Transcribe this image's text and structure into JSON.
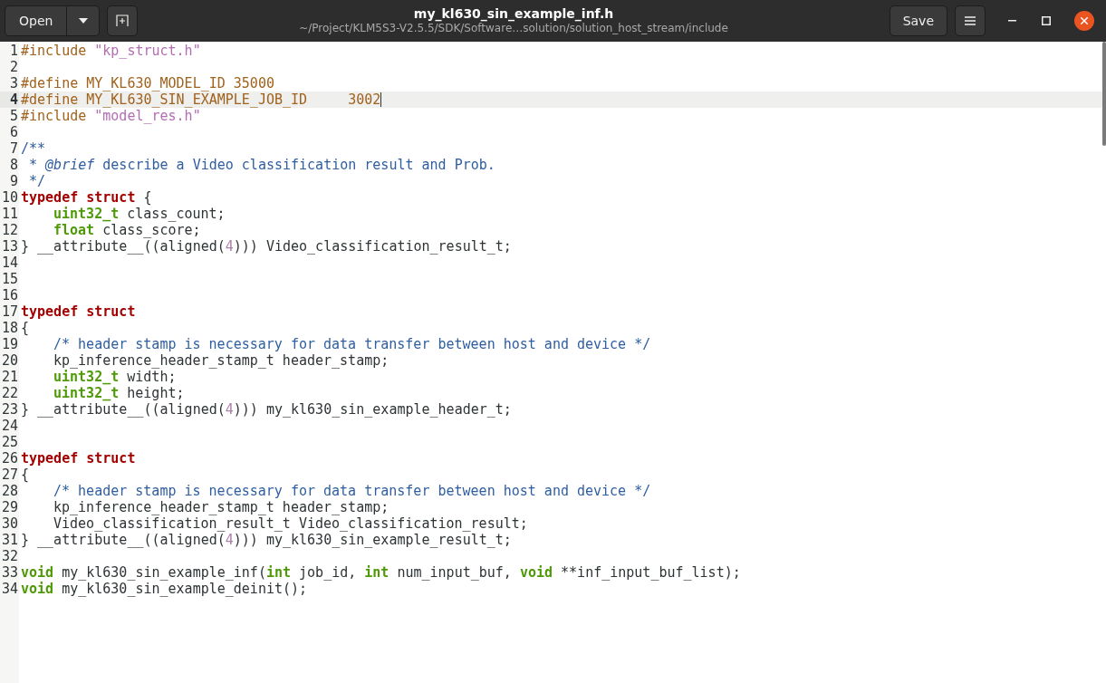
{
  "header": {
    "open_label": "Open",
    "title": "my_kl630_sin_example_inf.h",
    "subtitle": "~/Project/KLM5S3-V2.5.5/SDK/Software…solution/solution_host_stream/include",
    "save_label": "Save"
  },
  "lines": [
    {
      "number": "1",
      "current": false,
      "tokens": [
        {
          "kind": "preprocessor",
          "t": "#include "
        },
        {
          "kind": "string",
          "t": "\"kp_struct.h\""
        }
      ]
    },
    {
      "number": "2",
      "current": false
    },
    {
      "number": "3",
      "current": false,
      "tokens": [
        {
          "kind": "preprocessor",
          "t": "#define MY_KL630_MODEL_ID 35000"
        }
      ]
    },
    {
      "number": "4",
      "current": true,
      "tokens": [
        {
          "kind": "preprocessor",
          "t": "#define MY_KL630_SIN_EXAMPLE_JOB_ID     3002"
        }
      ]
    },
    {
      "number": "5",
      "current": false,
      "tokens": [
        {
          "kind": "preprocessor",
          "t": "#include "
        },
        {
          "kind": "string",
          "t": "\"model_res.h\""
        }
      ]
    },
    {
      "number": "6",
      "current": false
    },
    {
      "number": "7",
      "current": false,
      "tokens": [
        {
          "kind": "comment",
          "t": "/**"
        }
      ]
    },
    {
      "number": "8",
      "current": false,
      "tokens": [
        {
          "kind": "comment",
          "t": " * "
        },
        {
          "kind": "doc_tag",
          "t": "@brief"
        },
        {
          "kind": "comment",
          "t": " describe a Video classification result and Prob."
        }
      ]
    },
    {
      "number": "9",
      "current": false,
      "tokens": [
        {
          "kind": "comment",
          "t": " */"
        }
      ]
    },
    {
      "number": "10",
      "current": false,
      "tokens": [
        {
          "kind": "keyword",
          "t": "typedef struct"
        },
        {
          "kind": "plain",
          "t": " {"
        }
      ],
      "children": [
        {
          "number": "11",
          "current": false,
          "tokens": [
            {
              "kind": "type",
              "t": "uint32_t"
            },
            {
              "kind": "plain",
              "t": " class_count;"
            }
          ]
        },
        {
          "number": "12",
          "current": false,
          "tokens": [
            {
              "kind": "type",
              "t": "float"
            },
            {
              "kind": "plain",
              "t": " class_score;"
            }
          ]
        }
      ]
    },
    {
      "number": "13",
      "current": false,
      "tokens": [
        {
          "kind": "plain",
          "t": "} __attribute__((aligned("
        },
        {
          "kind": "number",
          "t": "4"
        },
        {
          "kind": "plain",
          "t": "))) Video_classification_result_t;"
        }
      ]
    },
    {
      "number": "14",
      "current": false
    },
    {
      "number": "15",
      "current": false
    },
    {
      "number": "16",
      "current": false
    },
    {
      "number": "17",
      "current": false,
      "tokens": [
        {
          "kind": "keyword",
          "t": "typedef struct"
        }
      ]
    },
    {
      "number": "18",
      "current": false,
      "tokens": [
        {
          "kind": "plain",
          "t": "{"
        }
      ],
      "children": [
        {
          "number": "19",
          "current": false,
          "tokens": [
            {
              "kind": "comment",
              "t": "/* header stamp is necessary for data transfer between host and device */"
            }
          ]
        },
        {
          "number": "20",
          "current": false,
          "tokens": [
            {
              "kind": "plain",
              "t": "kp_inference_header_stamp_t header_stamp;"
            }
          ]
        },
        {
          "number": "21",
          "current": false,
          "tokens": [
            {
              "kind": "type",
              "t": "uint32_t"
            },
            {
              "kind": "plain",
              "t": " width;"
            }
          ]
        },
        {
          "number": "22",
          "current": false,
          "tokens": [
            {
              "kind": "type",
              "t": "uint32_t"
            },
            {
              "kind": "plain",
              "t": " height;"
            }
          ]
        }
      ]
    },
    {
      "number": "23",
      "current": false,
      "tokens": [
        {
          "kind": "plain",
          "t": "} __attribute__((aligned("
        },
        {
          "kind": "number",
          "t": "4"
        },
        {
          "kind": "plain",
          "t": "))) my_kl630_sin_example_header_t;"
        }
      ]
    },
    {
      "number": "24",
      "current": false
    },
    {
      "number": "25",
      "current": false
    },
    {
      "number": "26",
      "current": false,
      "tokens": [
        {
          "kind": "keyword",
          "t": "typedef struct"
        }
      ]
    },
    {
      "number": "27",
      "current": false,
      "tokens": [
        {
          "kind": "plain",
          "t": "{"
        }
      ],
      "children": [
        {
          "number": "28",
          "current": false,
          "tokens": [
            {
              "kind": "comment",
              "t": "/* header stamp is necessary for data transfer between host and device */"
            }
          ]
        },
        {
          "number": "29",
          "current": false,
          "tokens": [
            {
              "kind": "plain",
              "t": "kp_inference_header_stamp_t header_stamp;"
            }
          ]
        },
        {
          "number": "30",
          "current": false,
          "tokens": [
            {
              "kind": "plain",
              "t": "Video_classification_result_t Video_classification_result;"
            }
          ]
        }
      ]
    },
    {
      "number": "31",
      "current": false,
      "tokens": [
        {
          "kind": "plain",
          "t": "} __attribute__((aligned("
        },
        {
          "kind": "number",
          "t": "4"
        },
        {
          "kind": "plain",
          "t": "))) my_kl630_sin_example_result_t;"
        }
      ]
    },
    {
      "number": "32",
      "current": false
    },
    {
      "number": "33",
      "current": false,
      "tokens": [
        {
          "kind": "type",
          "t": "void"
        },
        {
          "kind": "plain",
          "t": " my_kl630_sin_example_inf("
        },
        {
          "kind": "type",
          "t": "int"
        },
        {
          "kind": "plain",
          "t": " job_id, "
        },
        {
          "kind": "type",
          "t": "int"
        },
        {
          "kind": "plain",
          "t": " num_input_buf, "
        },
        {
          "kind": "type",
          "t": "void"
        },
        {
          "kind": "plain",
          "t": " **inf_input_buf_list);"
        }
      ]
    },
    {
      "number": "34",
      "current": false,
      "tokens": [
        {
          "kind": "type",
          "t": "void"
        },
        {
          "kind": "plain",
          "t": " my_kl630_sin_example_deinit();"
        }
      ]
    }
  ]
}
